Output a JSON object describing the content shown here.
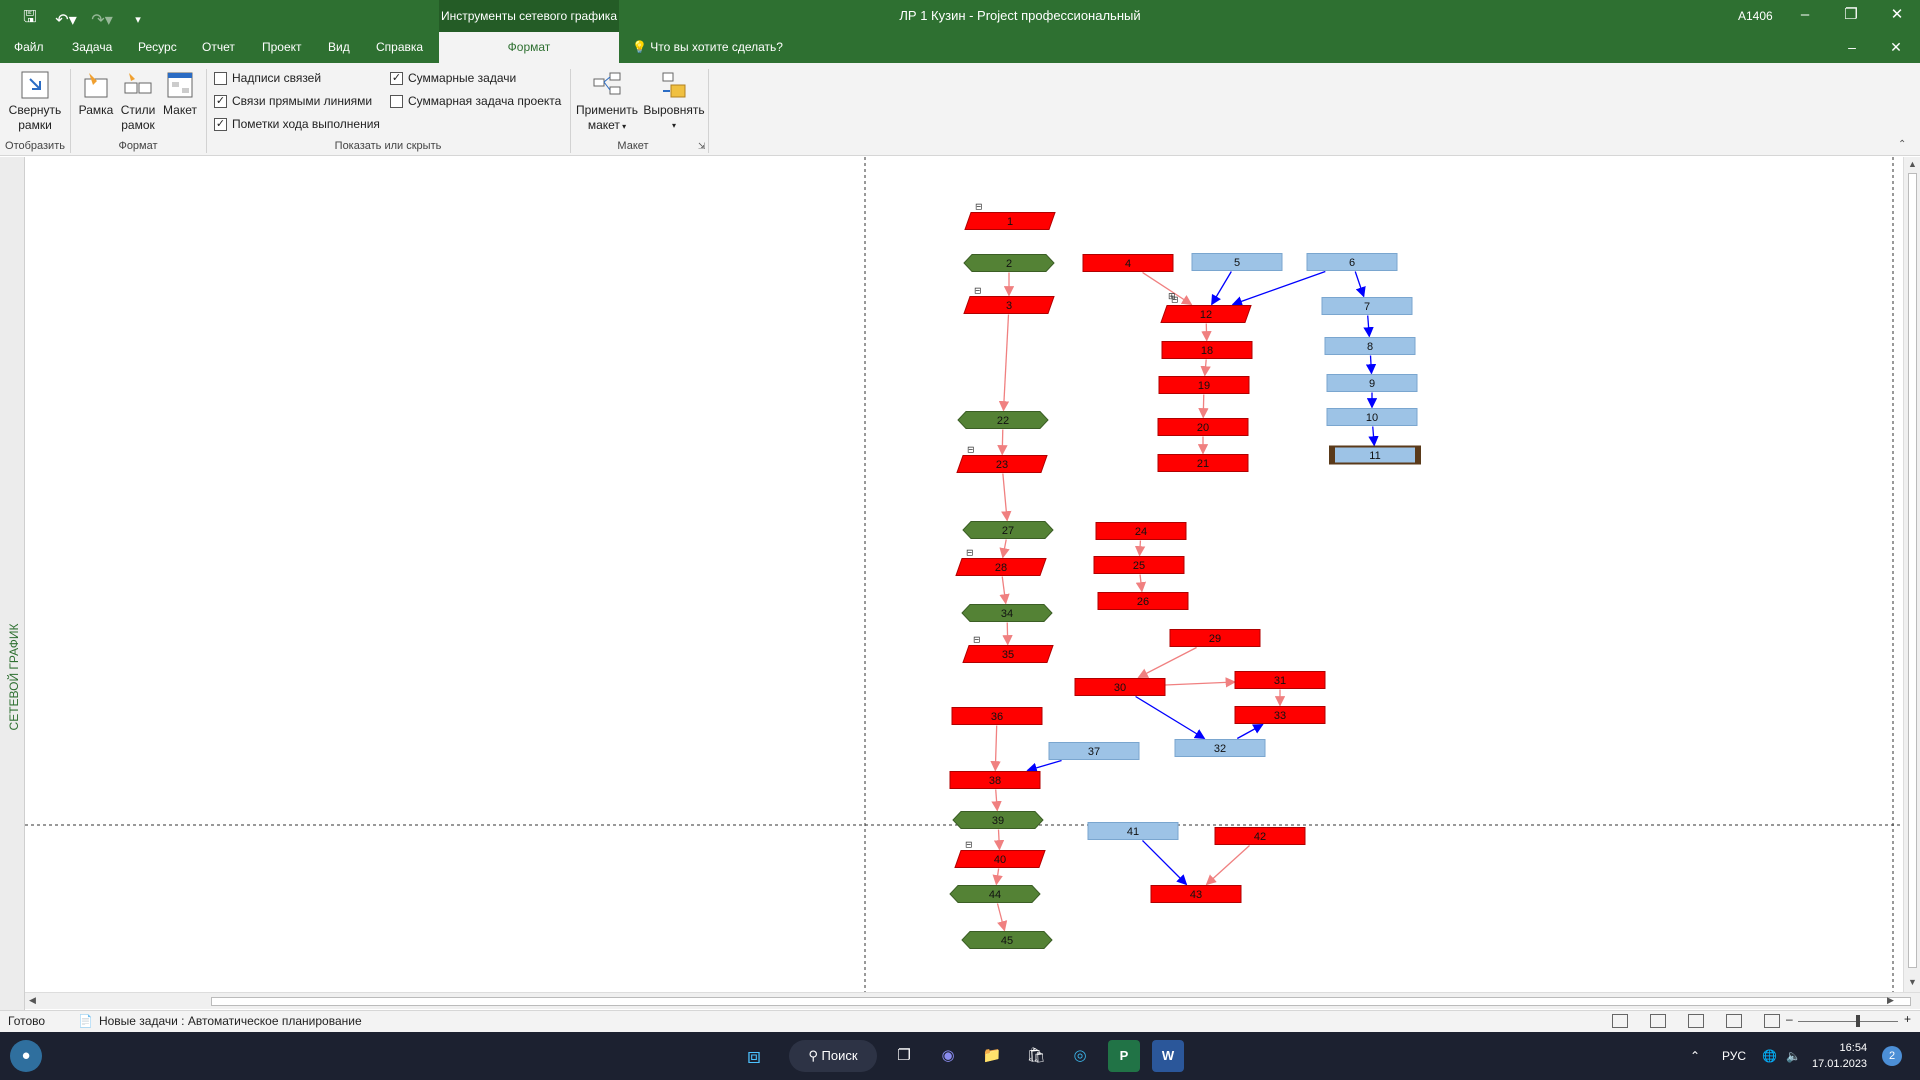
{
  "titlebar": {
    "context_tab_title": "Инструменты сетевого графика",
    "doc_title": "ЛР 1 Кузин  -  Project профессиональный",
    "user": "A1406",
    "save_icon": "save-icon",
    "undo_icon": "undo-icon",
    "redo_icon": "redo-icon",
    "customize_icon": "customize-qat-icon"
  },
  "tabs": [
    {
      "label": "Файл"
    },
    {
      "label": "Задача"
    },
    {
      "label": "Ресурс"
    },
    {
      "label": "Отчет"
    },
    {
      "label": "Проект"
    },
    {
      "label": "Вид"
    },
    {
      "label": "Справка"
    },
    {
      "label": "Формат",
      "active": true
    }
  ],
  "tellme": "Что вы хотите сделать?",
  "ribbon": {
    "collapse_label_1": "Свернуть",
    "collapse_label_2": "рамки",
    "frame_label": "Рамка",
    "styles_label_1": "Стили",
    "styles_label_2": "рамок",
    "layout_label": "Макет",
    "apply_label_1": "Применить",
    "apply_label_2": "макет",
    "align_label": "Выровнять",
    "group_display": "Отобразить",
    "group_format": "Формат",
    "group_showhide": "Показать или скрыть",
    "group_layout": "Макет",
    "checkboxes": [
      {
        "label": "Надписи связей",
        "checked": false
      },
      {
        "label": "Связи прямыми линиями",
        "checked": true
      },
      {
        "label": "Пометки хода выполнения",
        "checked": true
      },
      {
        "label": "Суммарные задачи",
        "checked": true
      },
      {
        "label": "Суммарная задача проекта",
        "checked": false
      }
    ]
  },
  "side_label": "СЕТЕВОЙ ГРАФИК",
  "network": {
    "colors": {
      "critical": "#ff0000",
      "summary": "#548235",
      "normal": "#9dc3e6",
      "critical_link": "#f08080",
      "normal_link": "#0000ff"
    },
    "nodes": [
      {
        "id": "1",
        "kind": "critical-summary-para"
      },
      {
        "id": "2",
        "kind": "summary-hex"
      },
      {
        "id": "3",
        "kind": "critical-summary-para"
      },
      {
        "id": "4",
        "kind": "critical"
      },
      {
        "id": "5",
        "kind": "normal"
      },
      {
        "id": "6",
        "kind": "normal"
      },
      {
        "id": "7",
        "kind": "normal"
      },
      {
        "id": "8",
        "kind": "normal"
      },
      {
        "id": "9",
        "kind": "normal"
      },
      {
        "id": "10",
        "kind": "normal"
      },
      {
        "id": "11",
        "kind": "milestone-normal"
      },
      {
        "id": "12",
        "kind": "critical-summary-para"
      },
      {
        "id": "18",
        "kind": "critical"
      },
      {
        "id": "19",
        "kind": "critical"
      },
      {
        "id": "20",
        "kind": "critical"
      },
      {
        "id": "21",
        "kind": "critical"
      },
      {
        "id": "22",
        "kind": "summary-hex"
      },
      {
        "id": "23",
        "kind": "critical-summary-para"
      },
      {
        "id": "24",
        "kind": "critical"
      },
      {
        "id": "25",
        "kind": "critical"
      },
      {
        "id": "26",
        "kind": "critical"
      },
      {
        "id": "27",
        "kind": "summary-hex"
      },
      {
        "id": "28",
        "kind": "critical-summary-para"
      },
      {
        "id": "29",
        "kind": "critical"
      },
      {
        "id": "30",
        "kind": "critical"
      },
      {
        "id": "31",
        "kind": "critical"
      },
      {
        "id": "32",
        "kind": "normal"
      },
      {
        "id": "33",
        "kind": "critical"
      },
      {
        "id": "34",
        "kind": "summary-hex"
      },
      {
        "id": "35",
        "kind": "critical-summary-para"
      },
      {
        "id": "36",
        "kind": "critical"
      },
      {
        "id": "37",
        "kind": "normal"
      },
      {
        "id": "38",
        "kind": "critical"
      },
      {
        "id": "39",
        "kind": "summary-hex"
      },
      {
        "id": "40",
        "kind": "critical-summary-para"
      },
      {
        "id": "41",
        "kind": "normal"
      },
      {
        "id": "42",
        "kind": "critical"
      },
      {
        "id": "43",
        "kind": "critical"
      },
      {
        "id": "44",
        "kind": "summary-hex"
      },
      {
        "id": "45",
        "kind": "summary-hex"
      }
    ],
    "links": [
      [
        "2",
        "3",
        "critical"
      ],
      [
        "3",
        "22",
        "critical"
      ],
      [
        "22",
        "23",
        "critical"
      ],
      [
        "23",
        "27",
        "critical"
      ],
      [
        "27",
        "28",
        "critical"
      ],
      [
        "28",
        "34",
        "critical"
      ],
      [
        "34",
        "35",
        "critical"
      ],
      [
        "36",
        "38",
        "critical"
      ],
      [
        "38",
        "39",
        "critical"
      ],
      [
        "39",
        "40",
        "critical"
      ],
      [
        "40",
        "44",
        "critical"
      ],
      [
        "44",
        "45",
        "critical"
      ],
      [
        "4",
        "12",
        "critical"
      ],
      [
        "5",
        "12",
        "normal"
      ],
      [
        "6",
        "12",
        "normal"
      ],
      [
        "6",
        "7",
        "normal"
      ],
      [
        "7",
        "8",
        "normal"
      ],
      [
        "8",
        "9",
        "normal"
      ],
      [
        "9",
        "10",
        "normal"
      ],
      [
        "10",
        "11",
        "normal"
      ],
      [
        "12",
        "18",
        "critical"
      ],
      [
        "18",
        "19",
        "critical"
      ],
      [
        "19",
        "20",
        "critical"
      ],
      [
        "20",
        "21",
        "critical"
      ],
      [
        "24",
        "25",
        "critical"
      ],
      [
        "25",
        "26",
        "critical"
      ],
      [
        "29",
        "30",
        "critical"
      ],
      [
        "30",
        "31",
        "critical"
      ],
      [
        "31",
        "33",
        "critical"
      ],
      [
        "30",
        "32",
        "normal"
      ],
      [
        "32",
        "33",
        "normal"
      ],
      [
        "37",
        "38",
        "normal"
      ],
      [
        "41",
        "43",
        "normal"
      ],
      [
        "42",
        "43",
        "critical"
      ]
    ]
  },
  "statusbar": {
    "ready": "Готово",
    "new_tasks": "Новые задачи : Автоматическое планирование"
  },
  "taskbar": {
    "search": "Поиск",
    "lang": "РУС",
    "time": "16:54",
    "date": "17.01.2023",
    "badge": "2"
  }
}
